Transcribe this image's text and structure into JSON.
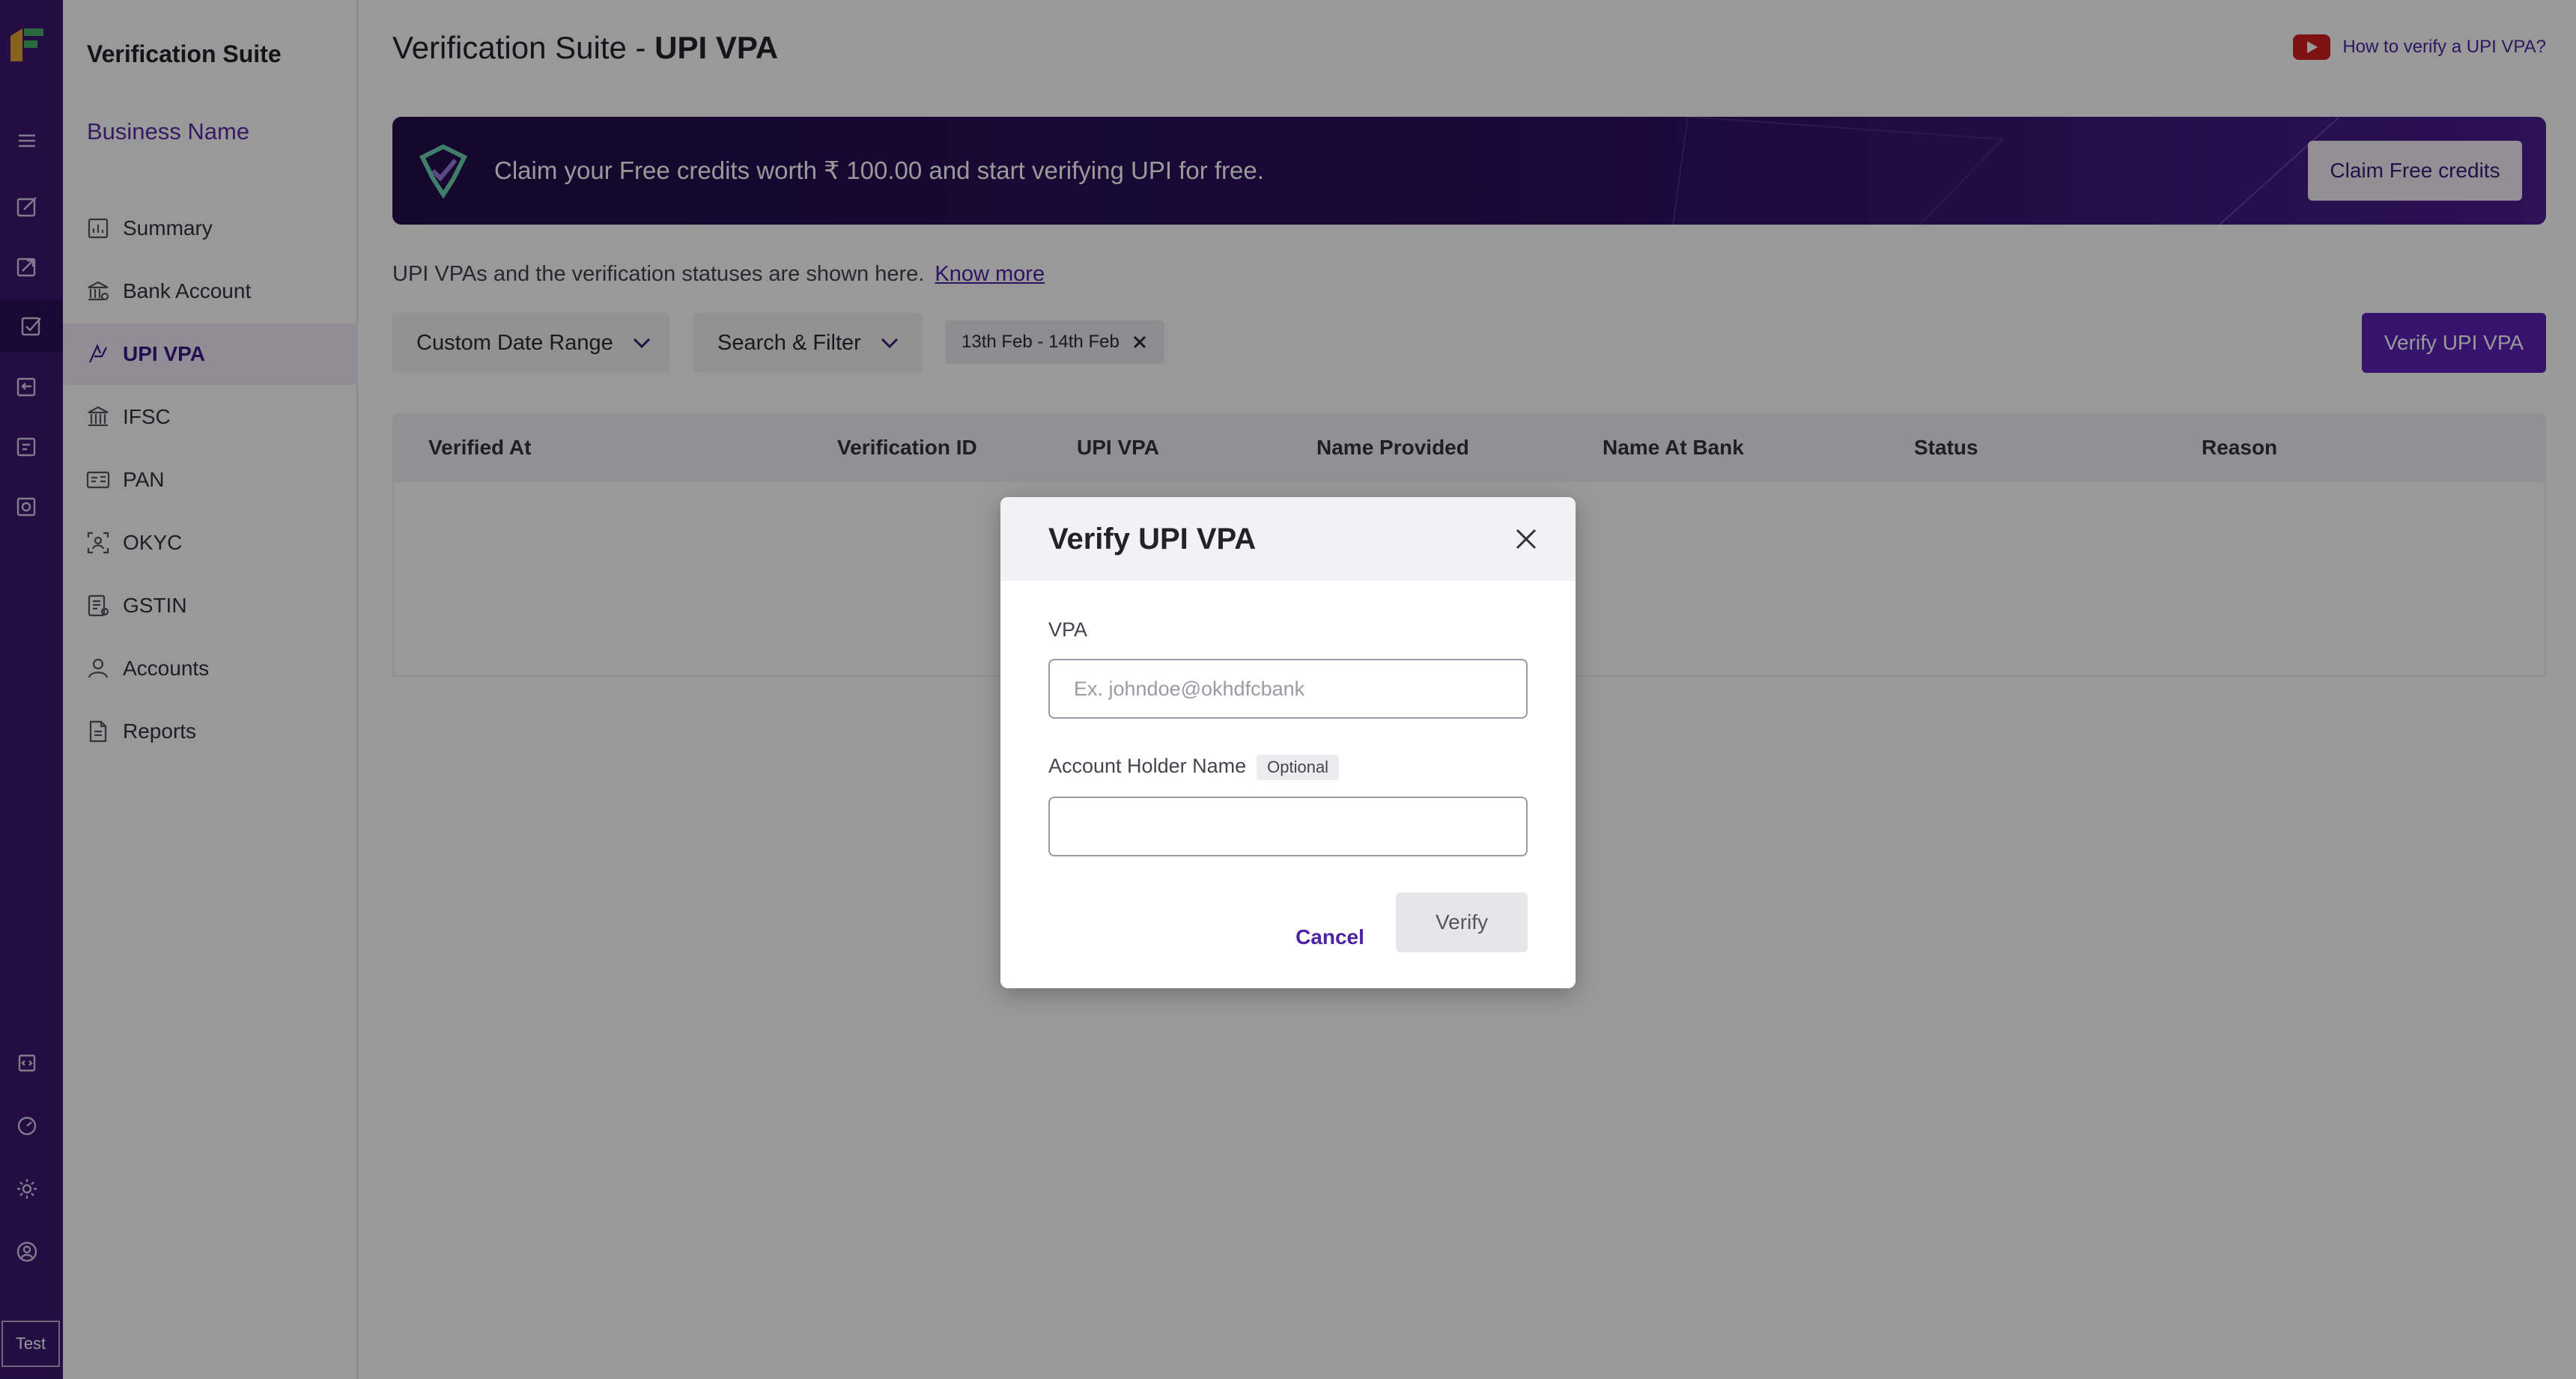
{
  "rail": {
    "test_label": "Test"
  },
  "sidebar": {
    "suite_title": "Verification Suite",
    "business_name": "Business Name",
    "items": [
      {
        "label": "Summary",
        "icon": "bar-chart-icon"
      },
      {
        "label": "Bank Account",
        "icon": "bank-icon"
      },
      {
        "label": "UPI VPA",
        "icon": "upi-icon",
        "active": true
      },
      {
        "label": "IFSC",
        "icon": "building-icon"
      },
      {
        "label": "PAN",
        "icon": "id-card-icon"
      },
      {
        "label": "OKYC",
        "icon": "face-scan-icon"
      },
      {
        "label": "GSTIN",
        "icon": "receipt-icon"
      },
      {
        "label": "Accounts",
        "icon": "user-icon"
      },
      {
        "label": "Reports",
        "icon": "document-icon"
      }
    ]
  },
  "header": {
    "title_prefix": "Verification Suite - ",
    "title_bold": "UPI VPA",
    "help_link": "How to verify a UPI VPA?"
  },
  "banner": {
    "text": "Claim your Free credits worth ₹ 100.00 and start verifying UPI for free.",
    "button": "Claim Free credits"
  },
  "description": {
    "text": "UPI VPAs and the verification statuses are shown here.",
    "link": "Know more"
  },
  "filters": {
    "date_range": "Custom Date Range",
    "search_filter": "Search & Filter",
    "chip": "13th Feb - 14th Feb",
    "verify_button": "Verify UPI VPA"
  },
  "table": {
    "columns": [
      "Verified At",
      "Verification ID",
      "UPI VPA",
      "Name Provided",
      "Name At Bank",
      "Status",
      "Reason"
    ]
  },
  "modal": {
    "title": "Verify UPI VPA",
    "vpa_label": "VPA",
    "vpa_placeholder": "Ex. johndoe@okhdfcbank",
    "vpa_value": "",
    "name_label": "Account Holder Name",
    "name_optional": "Optional",
    "name_value": "",
    "cancel": "Cancel",
    "verify": "Verify"
  }
}
